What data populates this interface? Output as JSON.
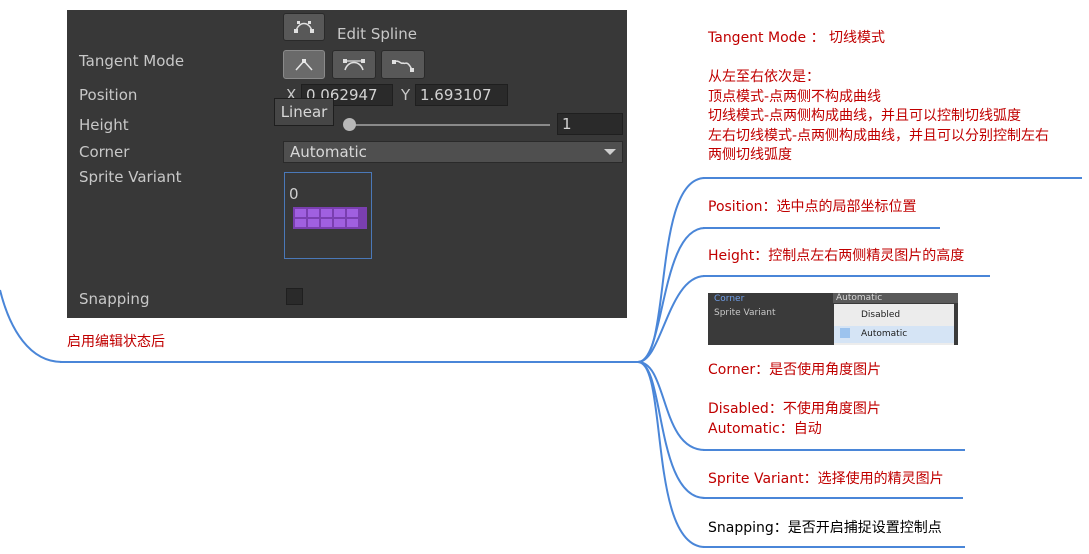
{
  "inspector": {
    "edit_spline_label": "Edit Spline",
    "tangent_mode_label": "Tangent Mode",
    "position_label": "Position",
    "position_x_axis": "X",
    "position_x_value": "0.062947",
    "position_y_axis": "Y",
    "position_y_value": "1.693107",
    "tooltip": "Linear",
    "height_label": "Height",
    "height_value": "1",
    "corner_label": "Corner",
    "corner_value": "Automatic",
    "sprite_variant_label": "Sprite Variant",
    "sprite_index": "0",
    "snapping_label": "Snapping"
  },
  "root_note": "启用编辑状态后",
  "notes": {
    "tangent_title": "Tangent Mode ： 切线模式",
    "tangent_order": "从左至右依次是：",
    "tangent_l1": "顶点模式-点两侧不构成曲线",
    "tangent_l2": "切线模式-点两侧构成曲线，并且可以控制切线弧度",
    "tangent_l3": "左右切线模式-点两侧构成曲线，并且可以分别控制左右",
    "tangent_l4": "两侧切线弧度",
    "position": "Position：选中点的局部坐标位置",
    "height": "Height：控制点左右两侧精灵图片的高度",
    "corner_title": "Corner：是否使用角度图片",
    "corner_disabled": "Disabled：不使用角度图片",
    "corner_automatic": "Automatic：自动",
    "sprite_variant": "Sprite Variant：选择使用的精灵图片",
    "snapping": "Snapping：是否开启捕捉设置控制点"
  },
  "mini_screenshot": {
    "corner_label": "Corner",
    "sprite_variant_label": "Sprite Variant",
    "header_value": "Automatic",
    "option_disabled": "Disabled",
    "option_automatic": "Automatic"
  },
  "colors": {
    "note_text": "#c00000",
    "branch_line": "#4a86d8",
    "inspector_bg": "#383838"
  }
}
